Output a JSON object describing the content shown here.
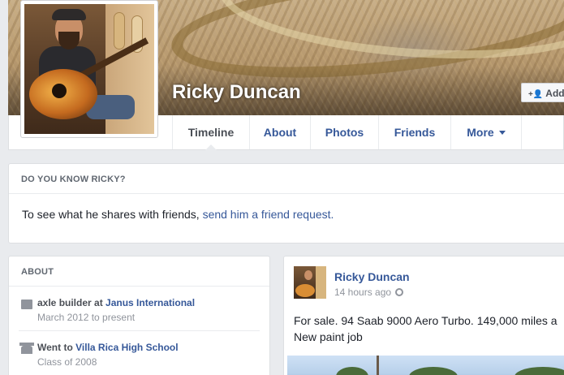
{
  "profile": {
    "name": "Ricky Duncan",
    "add_friend_label": "Add F"
  },
  "nav": {
    "tabs": [
      {
        "label": "Timeline",
        "active": true
      },
      {
        "label": "About"
      },
      {
        "label": "Photos"
      },
      {
        "label": "Friends"
      },
      {
        "label": "More"
      }
    ]
  },
  "know": {
    "header": "DO YOU KNOW RICKY?",
    "text": "To see what he shares with friends, ",
    "link": "send him a friend request."
  },
  "about": {
    "header": "ABOUT",
    "items": [
      {
        "prefix": "axle builder at ",
        "link": "Janus International",
        "sub": "March 2012 to present",
        "icon": "briefcase-icon"
      },
      {
        "prefix": "Went to ",
        "link": "Villa Rica High School",
        "sub": "Class of 2008",
        "icon": "school-icon"
      }
    ]
  },
  "post": {
    "author": "Ricky Duncan",
    "time": "14 hours ago",
    "line1": "For sale. 94 Saab 9000 Aero Turbo. 149,000 miles a",
    "line2": "New paint job"
  },
  "colors": {
    "link": "#365899",
    "background": "#e9ebee",
    "secondary_text": "#90949c"
  }
}
